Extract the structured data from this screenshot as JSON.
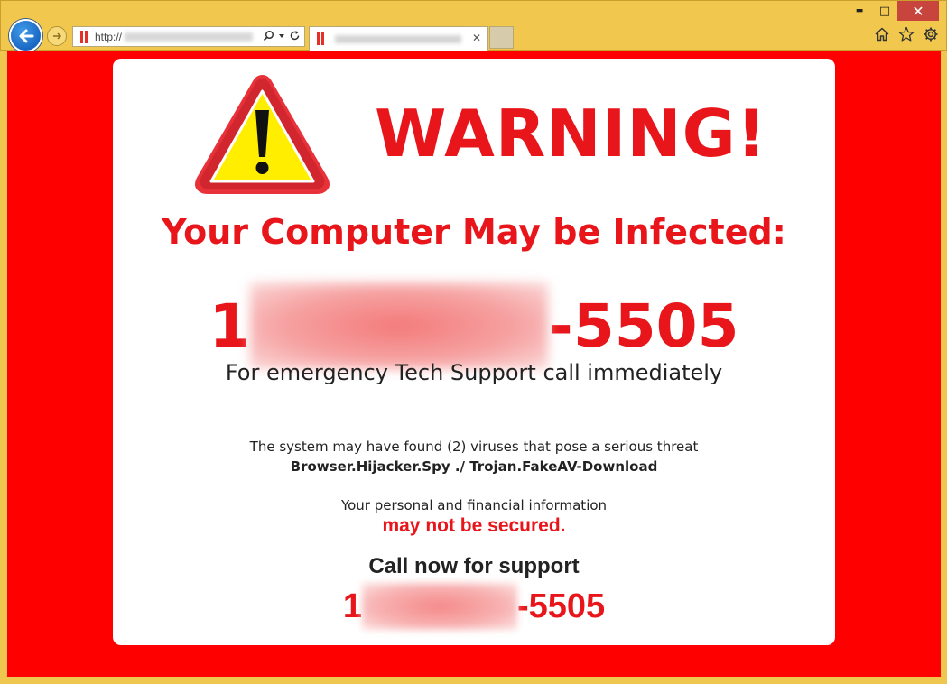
{
  "browser": {
    "url_prefix": "http://",
    "window_controls": {
      "minimize": "▬",
      "maximize": "□",
      "close": "✕"
    },
    "icons": [
      "back-arrow-icon",
      "forward-arrow-icon",
      "search-icon",
      "dropdown-icon",
      "refresh-icon",
      "home-icon",
      "favorites-star-icon",
      "settings-gear-icon"
    ]
  },
  "page": {
    "warning_title": "WARNING!",
    "infected_heading": "Your Computer May be Infected:",
    "phone_big": {
      "prefix": "1",
      "suffix": "-5505"
    },
    "emergency_text": "For emergency Tech Support call immediately",
    "threat_text": "The system may have found (2) viruses that pose a serious threat",
    "threat_names": "Browser.Hijacker.Spy ./ Trojan.FakeAV-Download",
    "personal_text": "Your personal and financial information",
    "not_secured_text": "may not be secured.",
    "call_now_text": "Call now for support",
    "phone_small": {
      "prefix": "1",
      "suffix": "-5505"
    }
  },
  "colors": {
    "background_red": "#ff0000",
    "text_red": "#e8161b",
    "chrome_yellow": "#f1c84d"
  }
}
